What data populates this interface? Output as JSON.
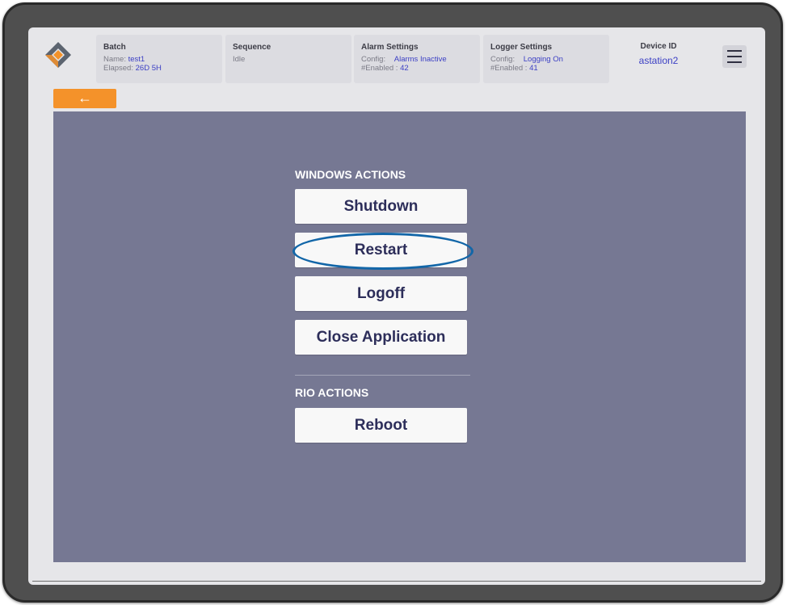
{
  "header": {
    "batch": {
      "title": "Batch",
      "name_label": "Name:",
      "name_value": "test1",
      "elapsed_label": "Elapsed:",
      "elapsed_value": "26D 5H"
    },
    "sequence": {
      "title": "Sequence",
      "status": "Idle"
    },
    "alarm_settings": {
      "title": "Alarm Settings",
      "config_label": "Config:",
      "config_value": "Alarms Inactive",
      "enabled_label": "#Enabled :",
      "enabled_value": "42"
    },
    "logger_settings": {
      "title": "Logger Settings",
      "config_label": "Config:",
      "config_value": "Logging On",
      "enabled_label": "#Enabled :",
      "enabled_value": "41"
    },
    "device": {
      "label": "Device ID",
      "value": "astation2"
    },
    "menu_icon": "hamburger-menu-icon",
    "logo_icon": "diamond-logo-icon"
  },
  "nav": {
    "back_icon": "arrow-left-icon",
    "back_label": "←"
  },
  "windows_actions": {
    "label": "WINDOWS ACTIONS",
    "buttons": [
      "Shutdown",
      "Restart",
      "Logoff",
      "Close Application"
    ]
  },
  "rio_actions": {
    "label": "RIO ACTIONS",
    "buttons": [
      "Reboot"
    ]
  },
  "highlight": {
    "target": "Restart",
    "color": "#1266a8"
  },
  "colors": {
    "accent": "#f4922a",
    "content_bg": "#767893",
    "value_text": "#3b3fc4",
    "button_text": "#2d2e5a"
  }
}
